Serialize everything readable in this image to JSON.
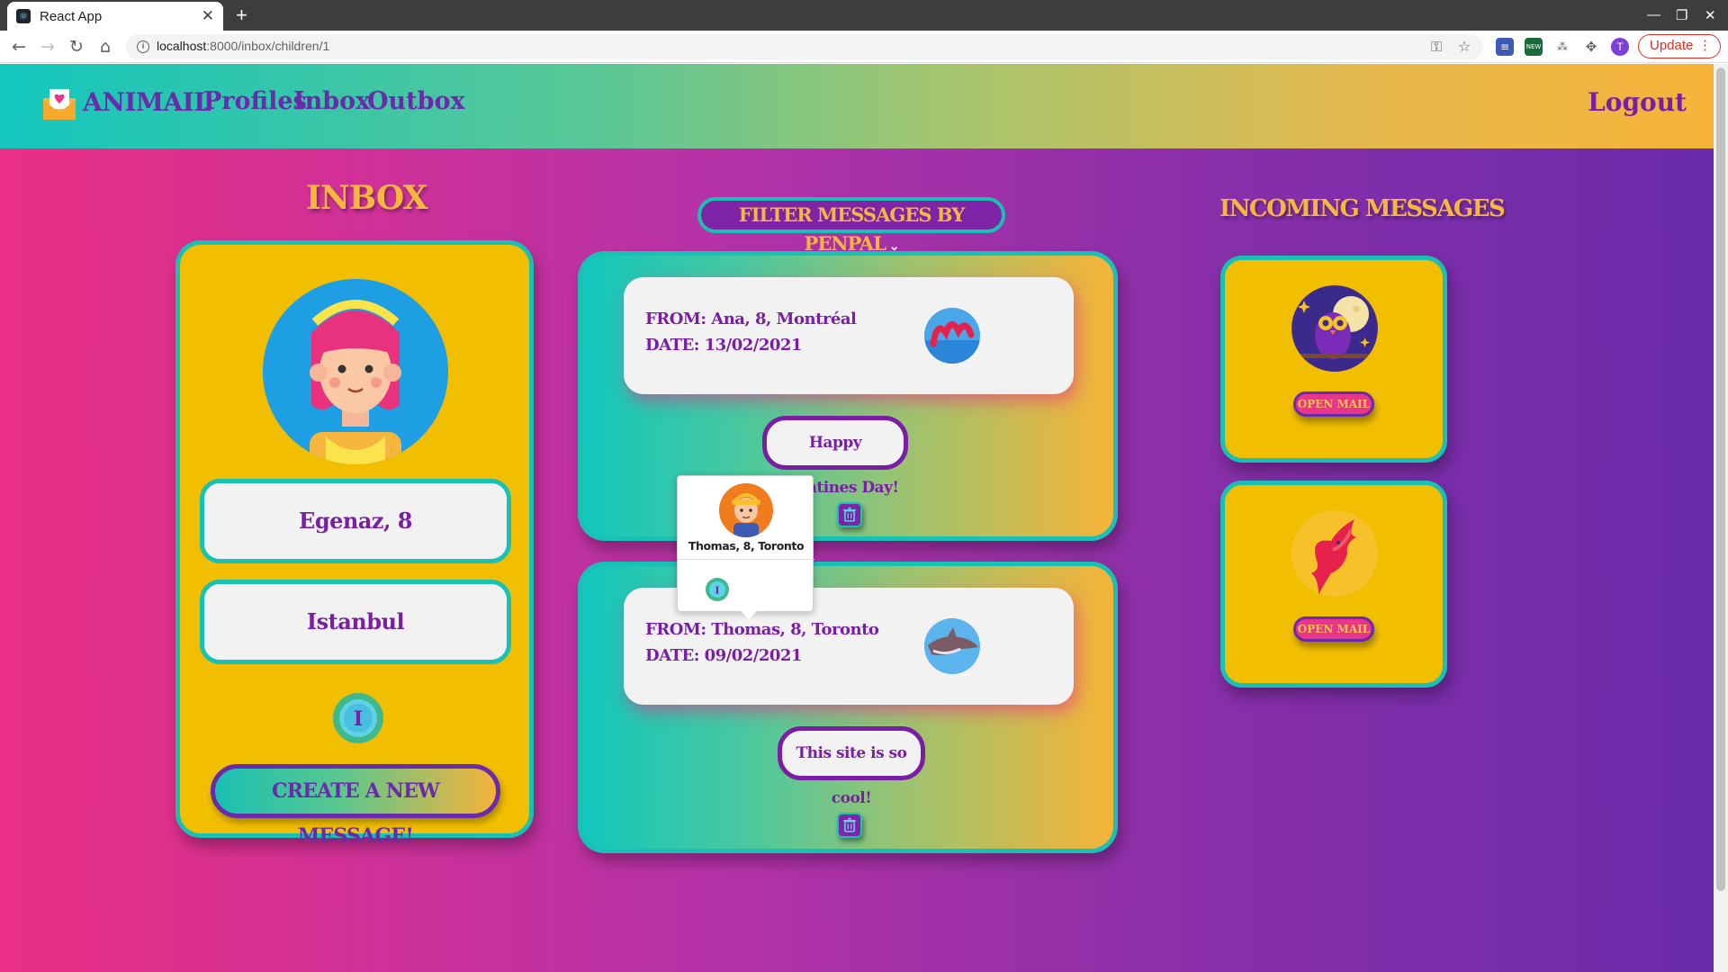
{
  "browser": {
    "tab_title": "React App",
    "url_host": "localhost",
    "url_path": ":8000/inbox/children/1",
    "update_label": "Update",
    "avatar_initial": "T",
    "ext_new_badge": "NEW"
  },
  "nav": {
    "brand": "ANIMAIL",
    "links": [
      "Profiles",
      "Inbox",
      "Outbox"
    ],
    "logout": "Logout"
  },
  "profile": {
    "title": "INBOX",
    "name_age": "Egenaz, 8",
    "city": "Istanbul",
    "badge_letter": "I",
    "create_button": "CREATE A NEW MESSAGE!"
  },
  "messages": {
    "filter_label": "FILTER MESSAGES BY PENPAL",
    "items": [
      {
        "from": "FROM: Ana, 8, Montréal",
        "date": "DATE: 13/02/2021",
        "body": "Happy Valentines Day!",
        "animal_icon": "sea-serpent-icon"
      },
      {
        "from": "FROM: Thomas, 8, Toronto",
        "date": "DATE: 09/02/2021",
        "body": "This site is so cool!",
        "animal_icon": "dolphin-icon"
      }
    ],
    "tooltip": {
      "name": "Thomas, 8, Toronto",
      "badge_letter": "I"
    }
  },
  "incoming": {
    "title": "INCOMING MESSAGES",
    "items": [
      {
        "animal_icon": "owl-icon",
        "button": "OPEN MAIL"
      },
      {
        "animal_icon": "phoenix-icon",
        "button": "OPEN MAIL"
      }
    ]
  },
  "colors": {
    "purple": "#6a2bab",
    "teal": "#19c0b4",
    "yellow": "#f2bf00",
    "pink": "#ea2f85"
  }
}
